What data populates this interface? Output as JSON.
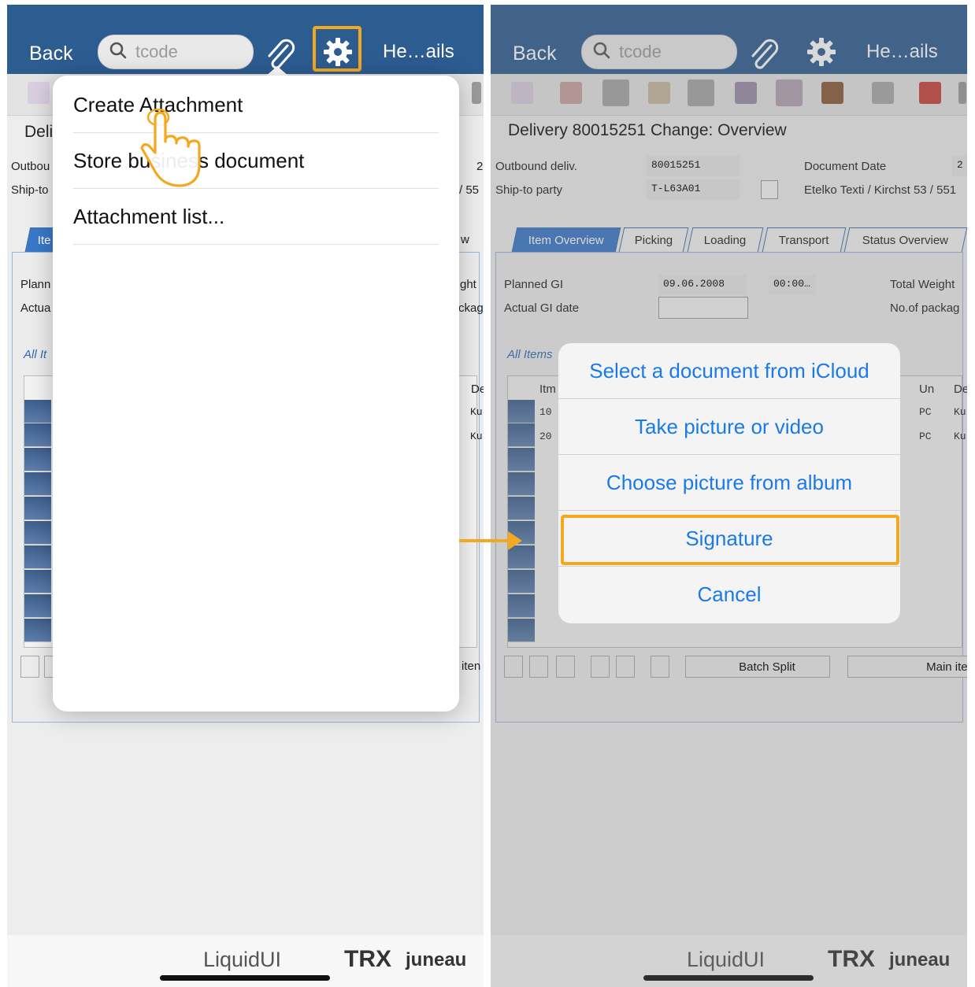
{
  "nav": {
    "back": "Back",
    "search_placeholder": "tcode",
    "details": "He…ails"
  },
  "left": {
    "title_fragment": "Deli",
    "outbound_fragment": "Outbou",
    "shipto_fragment": "Ship-to",
    "right_frag_doc": "2",
    "right_frag_ship": "/ 55",
    "tab_fragment": "Ite",
    "tab_right_fragment": "w",
    "planned_fragment": "Plann",
    "actual_fragment": "Actua",
    "weight_fragment": "ght",
    "package_fragment": "ckag",
    "allitems_fragment": "All It",
    "col_de": "De",
    "cell_ku": "Ku",
    "main_item_fragment": "iten",
    "menu": [
      "Create Attachment",
      "Store business document",
      "Attachment list..."
    ]
  },
  "right": {
    "title": "Delivery 80015251 Change: Overview",
    "outbound_label": "Outbound deliv.",
    "outbound_value": "80015251",
    "shipto_label": "Ship-to party",
    "shipto_value": "T-L63A01",
    "docdate_label": "Document Date",
    "docdate_value": "2",
    "shipto_address": "Etelko Texti / Kirchst 53 / 551",
    "tabs": [
      "Item Overview",
      "Picking",
      "Loading",
      "Transport",
      "Status Overview"
    ],
    "planned_label": "Planned GI",
    "planned_date": "09.06.2008",
    "planned_time": "00:00…",
    "actual_label": "Actual GI date",
    "total_weight": "Total Weight",
    "packages": "No.of packag",
    "all_items": "All Items",
    "col_itm": "Itm",
    "col_un": "Un",
    "col_de": "De",
    "rows": [
      {
        "itm": "10",
        "un": "PC",
        "de": "Ku"
      },
      {
        "itm": "20",
        "un": "PC",
        "de": "Ku"
      }
    ],
    "batch_split": "Batch Split",
    "main_item": "Main iten",
    "sheet": [
      "Select a document from iCloud",
      "Take picture or video",
      "Choose picture from album",
      "Signature",
      "Cancel"
    ]
  },
  "footer": {
    "liquidui": "LiquidUI",
    "trx": "TRX",
    "juneau": "juneau"
  },
  "colors": {
    "accent": "#f2a81f",
    "navbar": "#2d5c91",
    "ios_blue": "#1a7ae8"
  }
}
